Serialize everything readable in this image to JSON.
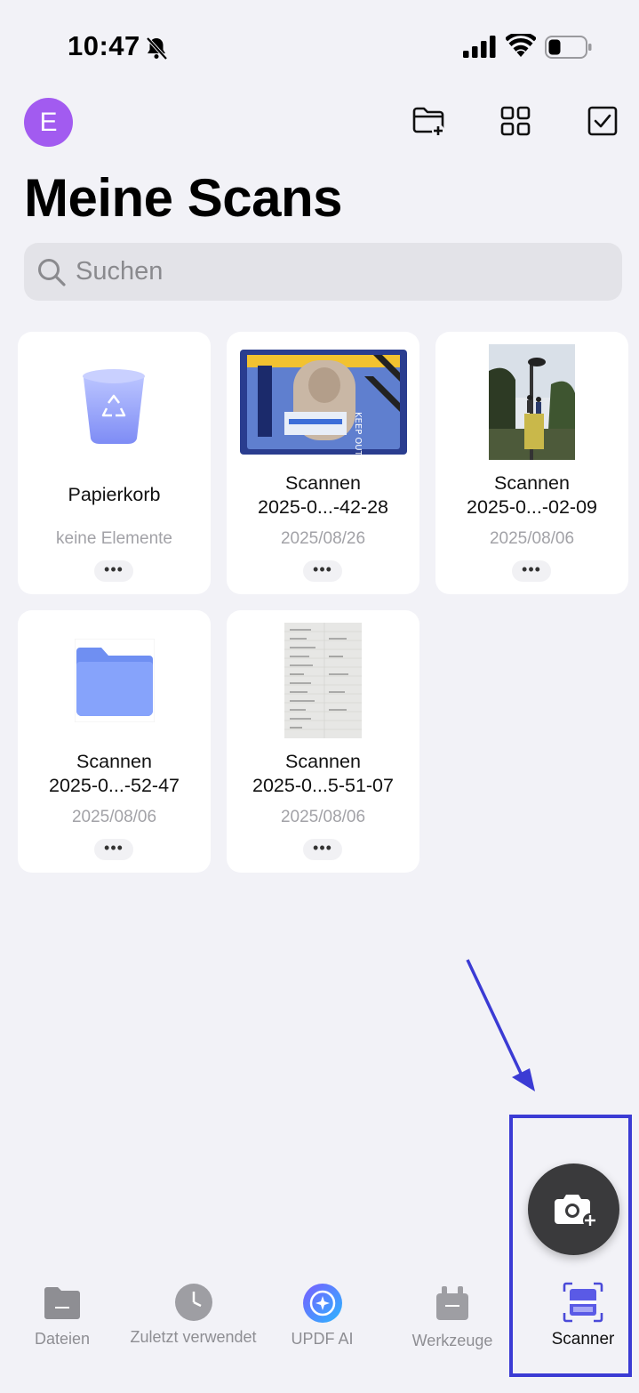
{
  "status_bar": {
    "time": "10:47"
  },
  "header": {
    "avatar_letter": "E",
    "title": "Meine Scans",
    "icons": [
      "new-folder-icon",
      "grid-view-icon",
      "select-checkbox-icon"
    ]
  },
  "search": {
    "placeholder": "Suchen"
  },
  "items": [
    {
      "name": "Papierkorb",
      "subtitle": "keine Elemente",
      "more": "•••",
      "kind": "trash"
    },
    {
      "name_line1": "Scannen",
      "name_line2": "2025-0...-42-28",
      "subtitle": "2025/08/26",
      "more": "•••",
      "kind": "scan-id-card"
    },
    {
      "name_line1": "Scannen",
      "name_line2": "2025-0...-02-09",
      "subtitle": "2025/08/06",
      "more": "•••",
      "kind": "scan-photo"
    },
    {
      "name_line1": "Scannen",
      "name_line2": "2025-0...-52-47",
      "subtitle": "2025/08/06",
      "more": "•••",
      "kind": "folder"
    },
    {
      "name_line1": "Scannen",
      "name_line2": "2025-0...5-51-07",
      "subtitle": "2025/08/06",
      "more": "•••",
      "kind": "scan-notes"
    }
  ],
  "tabbar": {
    "tabs": [
      {
        "label": "Dateien",
        "icon": "files-icon"
      },
      {
        "label": "Zuletzt verwendet",
        "icon": "clock-icon"
      },
      {
        "label": "UPDF AI",
        "icon": "updf-ai-icon"
      },
      {
        "label": "Werkzeuge",
        "icon": "tools-icon"
      },
      {
        "label": "Scanner",
        "icon": "scanner-icon",
        "active": true
      }
    ]
  },
  "colors": {
    "accent": "#3b3bd4",
    "avatar": "#a25bf0",
    "fab": "#3a3a3c"
  }
}
